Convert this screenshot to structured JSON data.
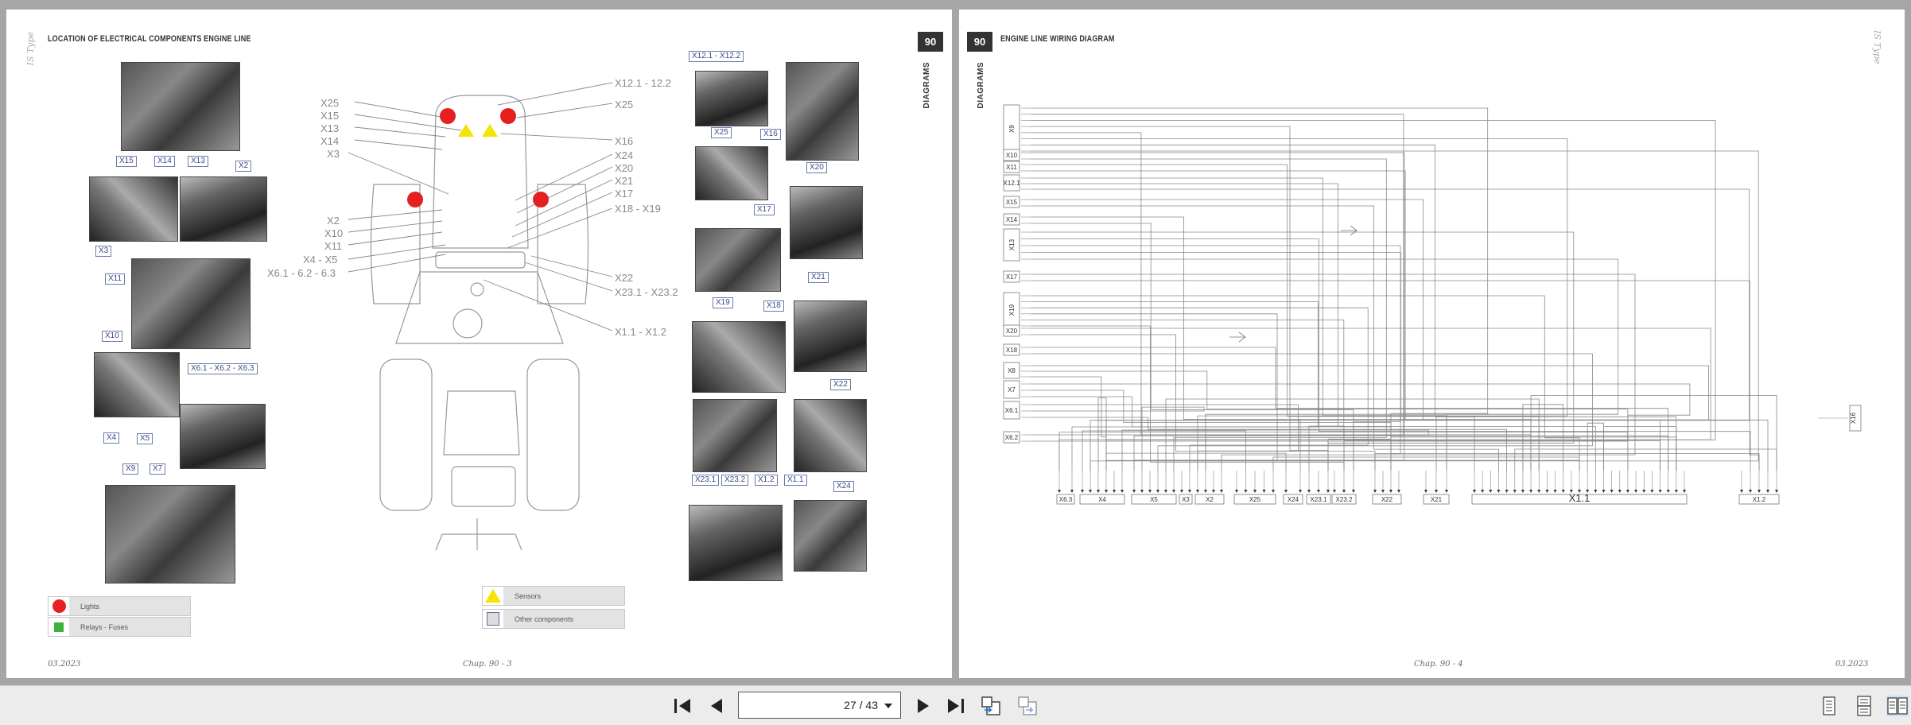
{
  "viewer": {
    "page_indicator": "27 / 43"
  },
  "left_page": {
    "brand": "IS Type",
    "title": "LOCATION OF ELECTRICAL COMPONENTS ENGINE LINE",
    "page_number": "90",
    "section": "DIAGRAMS",
    "footer_date": "03.2023",
    "footer_chapter": "Chap. 90 - 3",
    "legend": {
      "lights": "Lights",
      "relays": "Relays - Fuses",
      "sensors": "Sensors",
      "other": "Other components"
    },
    "tractor_labels_left": [
      "X25",
      "X15",
      "X13",
      "X14",
      "X3",
      "X2",
      "X10",
      "X11",
      "X4 - X5",
      "X6.1 - 6.2 - 6.3"
    ],
    "tractor_labels_right": [
      "X12.1 - 12.2",
      "X25",
      "X16",
      "X24",
      "X20",
      "X21",
      "X17",
      "X18 - X19",
      "X22",
      "X23.1 - X23.2",
      "X1.1 - X1.2"
    ],
    "photo_tags": [
      "X15",
      "X14",
      "X13",
      "X2",
      "X3",
      "X11",
      "X10",
      "X6.1 - X6.2 - X6.3",
      "X4",
      "X5",
      "X9",
      "X7",
      "X12.1 - X12.2",
      "X25",
      "X16",
      "X20",
      "X17",
      "X19",
      "X18",
      "X21",
      "X22",
      "X23.1",
      "X23.2",
      "X1.2",
      "X1.1",
      "X24"
    ]
  },
  "right_page": {
    "brand": "IS Type",
    "title": "ENGINE LINE WIRING DIAGRAM",
    "page_number": "90",
    "section": "DIAGRAMS",
    "footer_chapter": "Chap. 90 - 4",
    "footer_date": "03.2023",
    "left_connectors": [
      "X9",
      "X10",
      "X11",
      "X12.1",
      "X15",
      "X14",
      "X13",
      "X17",
      "X19",
      "X20",
      "X18",
      "X8",
      "X7",
      "X6.1",
      "X6.2"
    ],
    "bottom_connectors": [
      "X6.3",
      "X4",
      "X5",
      "X3",
      "X2",
      "X25",
      "X24",
      "X23.1",
      "X23.2",
      "X22",
      "X21",
      "X1.1",
      "X1.2"
    ],
    "right_connector": "X16"
  }
}
